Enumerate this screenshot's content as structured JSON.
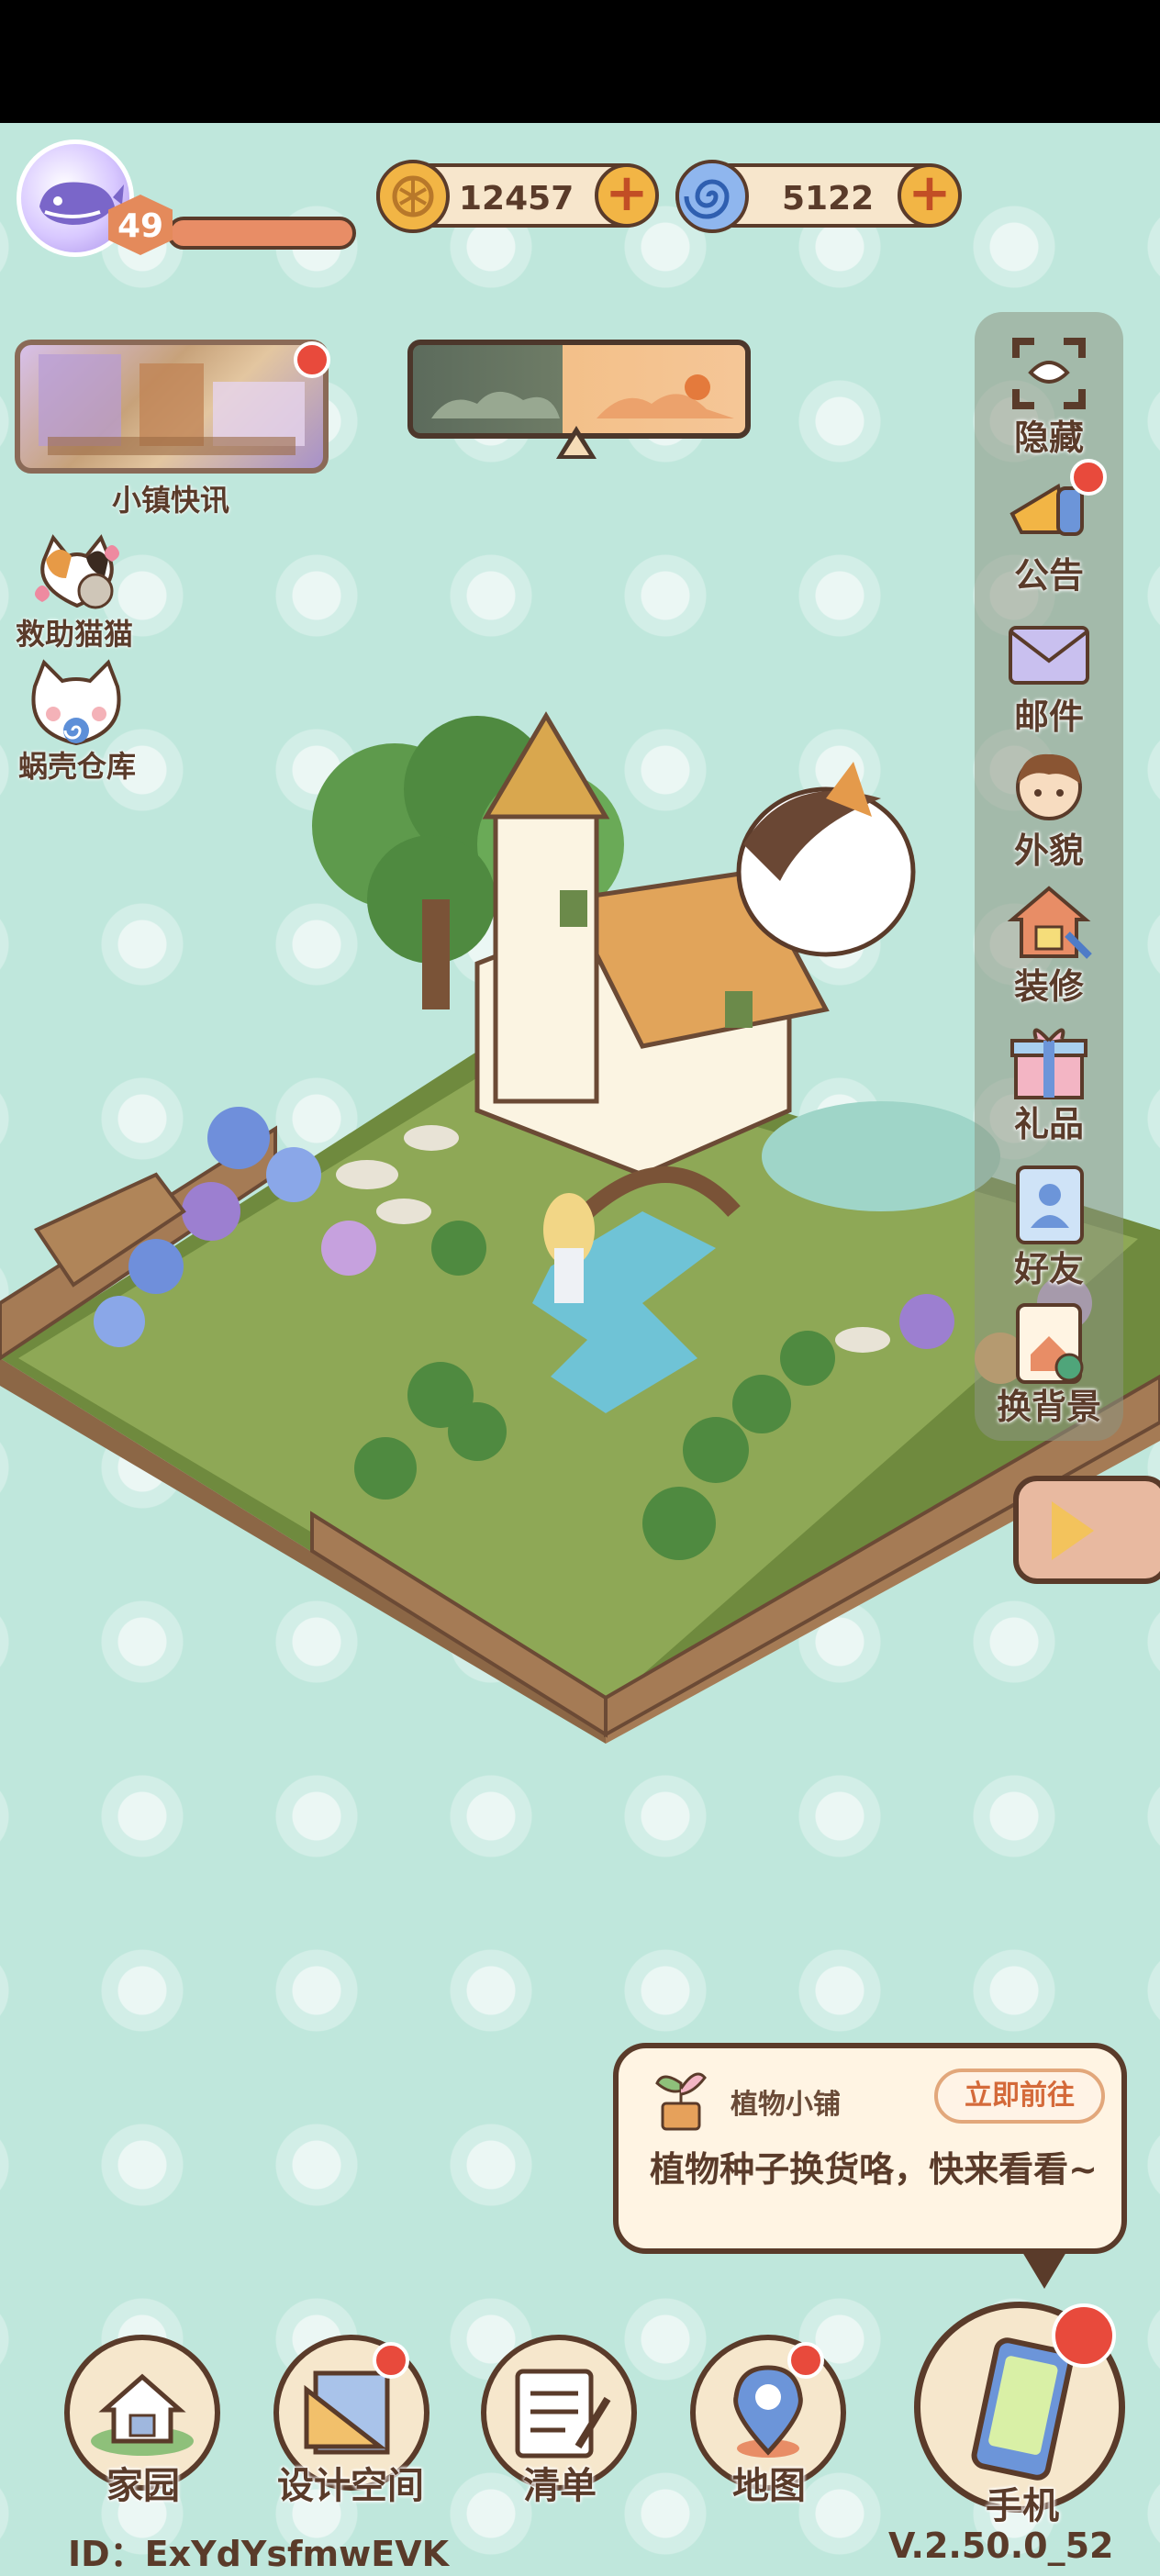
{
  "player": {
    "level": "49"
  },
  "currency": {
    "coins": "12457",
    "shells": "5122"
  },
  "news": {
    "label": "小镇快讯"
  },
  "left_menu": [
    {
      "label": "救助猫猫",
      "icon": "cat-icon"
    },
    {
      "label": "蜗壳仓库",
      "icon": "storage-cat-icon"
    }
  ],
  "right_menu": [
    {
      "label": "隐藏",
      "icon": "hide-icon"
    },
    {
      "label": "公告",
      "icon": "announcement-icon"
    },
    {
      "label": "邮件",
      "icon": "mail-icon"
    },
    {
      "label": "外貌",
      "icon": "appearance-icon"
    },
    {
      "label": "装修",
      "icon": "decorate-icon"
    },
    {
      "label": "礼品",
      "icon": "gift-icon"
    },
    {
      "label": "好友",
      "icon": "friends-icon"
    },
    {
      "label": "换背景",
      "icon": "change-background-icon"
    }
  ],
  "notice": {
    "title": "植物小铺",
    "button": "立即前往",
    "message": "植物种子换货咯，快来看看~"
  },
  "bottom_nav": [
    {
      "label": "家园",
      "icon": "home-icon"
    },
    {
      "label": "设计空间",
      "icon": "design-space-icon"
    },
    {
      "label": "清单",
      "icon": "list-icon"
    },
    {
      "label": "地图",
      "icon": "map-icon"
    },
    {
      "label": "手机",
      "icon": "phone-icon"
    }
  ],
  "footer": {
    "id": "ID：ExYdYsfmwEVK",
    "version": "V.2.50.0_52"
  },
  "colors": {
    "accent": "#e84a3c",
    "brown": "#5a3b2a",
    "background": "#bfe7dc"
  }
}
